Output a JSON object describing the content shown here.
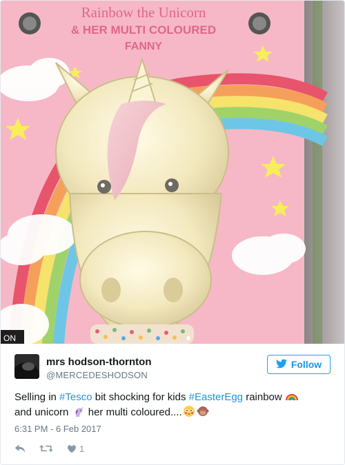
{
  "image": {
    "box_title_line1": "Rainbow the Unicorn",
    "box_title_line2": "& HER MULTI COLOURED",
    "box_title_line3": "FANNY",
    "corner_text": "ON"
  },
  "tweet": {
    "author_name": "mrs hodson-thornton",
    "author_handle": "@MERCEDESHODSON",
    "follow_label": "Follow",
    "text_part1": "Selling in ",
    "hashtag1": "#Tesco",
    "text_part2": " bit shocking for kids ",
    "hashtag2": "#EasterEgg",
    "text_part3": " rainbow ",
    "text_part4": "and unicorn ",
    "text_part5": " her multi coloured....",
    "timestamp": "6:31 PM - 6 Feb 2017",
    "like_count": "1"
  },
  "icons": {
    "rainbow": "rainbow-emoji",
    "unicorn": "unicorn-emoji",
    "flushed": "flushed-face-emoji",
    "monkey": "see-no-evil-monkey-emoji",
    "reply": "reply-icon",
    "retweet": "retweet-icon",
    "like": "heart-icon",
    "twitter": "twitter-bird-icon"
  },
  "colors": {
    "accent": "#1da1f2",
    "link": "#1b95e0",
    "muted": "#657786"
  }
}
